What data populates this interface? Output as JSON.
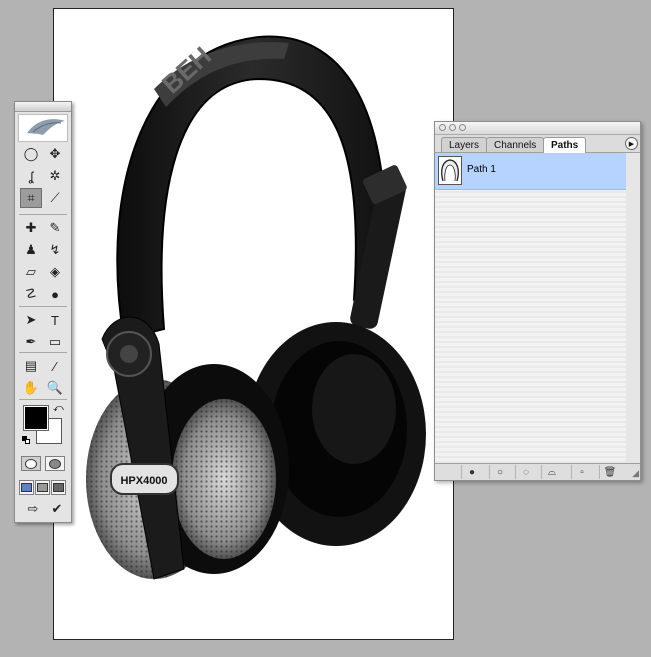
{
  "canvas": {
    "image": {
      "brand_text": "BEH",
      "model_text": "HPX4000"
    }
  },
  "toolbox": {
    "tools": [
      {
        "name": "marquee-tool-icon",
        "glyph": "◯"
      },
      {
        "name": "move-tool-icon",
        "glyph": "✥"
      },
      {
        "name": "lasso-tool-icon",
        "glyph": "ʆ"
      },
      {
        "name": "magic-wand-tool-icon",
        "glyph": "✲"
      },
      {
        "name": "crop-tool-icon",
        "glyph": "⌗"
      },
      {
        "name": "slice-tool-icon",
        "glyph": "⟋"
      },
      {
        "name": "healing-brush-tool-icon",
        "glyph": "✚"
      },
      {
        "name": "brush-tool-icon",
        "glyph": "✎"
      },
      {
        "name": "clone-stamp-tool-icon",
        "glyph": "♟"
      },
      {
        "name": "history-brush-tool-icon",
        "glyph": "↯"
      },
      {
        "name": "eraser-tool-icon",
        "glyph": "▱"
      },
      {
        "name": "paint-bucket-tool-icon",
        "glyph": "◈"
      },
      {
        "name": "smudge-tool-icon",
        "glyph": "☡"
      },
      {
        "name": "dodge-tool-icon",
        "glyph": "●"
      },
      {
        "name": "path-selection-tool-icon",
        "glyph": "➤"
      },
      {
        "name": "type-tool-icon",
        "glyph": "T"
      },
      {
        "name": "pen-tool-icon",
        "glyph": "✒"
      },
      {
        "name": "rectangle-tool-icon",
        "glyph": "▭"
      },
      {
        "name": "notes-tool-icon",
        "glyph": "▤"
      },
      {
        "name": "eyedropper-tool-icon",
        "glyph": "⁄"
      },
      {
        "name": "hand-tool-icon",
        "glyph": "✋"
      },
      {
        "name": "zoom-tool-icon",
        "glyph": "🔍"
      }
    ],
    "active_tool": "crop-tool-icon",
    "foreground_color": "#000000",
    "background_color": "#ffffff"
  },
  "palette": {
    "tabs": [
      {
        "label": "Layers",
        "active": false
      },
      {
        "label": "Channels",
        "active": false
      },
      {
        "label": "Paths",
        "active": true
      }
    ],
    "paths": [
      {
        "name": "Path 1",
        "selected": true
      }
    ],
    "bottom_buttons": [
      {
        "name": "fill-path-icon",
        "glyph": "●"
      },
      {
        "name": "stroke-path-icon",
        "glyph": "○"
      },
      {
        "name": "load-selection-icon",
        "glyph": "◌"
      },
      {
        "name": "make-work-path-icon",
        "glyph": "⌓"
      },
      {
        "name": "new-path-icon",
        "glyph": "▫"
      },
      {
        "name": "delete-path-icon",
        "glyph": "🗑"
      }
    ],
    "selection_color": "#b6d3ff"
  }
}
